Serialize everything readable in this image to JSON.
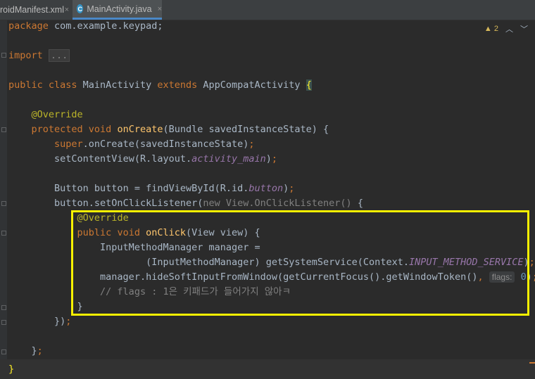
{
  "tabs": [
    {
      "label": "roidManifest.xml",
      "close": "×"
    },
    {
      "label": "MainActivity.java",
      "icon": "C",
      "close": "×"
    }
  ],
  "inspection": {
    "count": "2"
  },
  "code": {
    "l1_kw": "package",
    "l1_rest": " com.example.keypad;",
    "l2_kw": "import",
    "l2_fold": "...",
    "l3_kw1": "public class",
    "l3_name": " MainActivity ",
    "l3_kw2": "extends",
    "l3_parent": " AppCompatActivity ",
    "l3_brace": "{",
    "l4_ann": "@Override",
    "l5_kw": "protected void",
    "l5_fn": "onCreate",
    "l5_rest": "(Bundle savedInstanceState) {",
    "l6_kw": "super",
    "l6_rest": ".onCreate(savedInstanceState)",
    "l6_semi": ";",
    "l7_a": "setContentView(R.layout.",
    "l7_field": "activity_main",
    "l7_b": ")",
    "l7_semi": ";",
    "l8_a": "Button button = findViewById(R.id.",
    "l8_field": "button",
    "l8_b": ")",
    "l8_semi": ";",
    "l9_a": "button.setOnClickListener(",
    "l9_dim": "new View.OnClickListener() ",
    "l9_b": "{",
    "l10_ann": "@Override",
    "l11_kw": "public void",
    "l11_fn": "onClick",
    "l11_rest": "(View view) {",
    "l12": "InputMethodManager manager =",
    "l13_a": "(InputMethodManager) getSystemService(Context.",
    "l13_field": "INPUT_METHOD_SERVICE",
    "l13_b": ")",
    "l13_semi": ";",
    "l14_a": "manager.hideSoftInputFromWindow(getCurrentFocus().getWindowToken()",
    "l14_comma": ", ",
    "l14_hint": "flags:",
    "l14_num": "0",
    "l14_b": ")",
    "l14_semi": ";",
    "l15_cmt": "// flags : 1은 키패드가 들어가지 않아ㅋ",
    "l16": "}",
    "l17_a": "})",
    "l17_semi": ";",
    "l18_a": "}",
    "l18_semi": ";",
    "l19": "}"
  }
}
